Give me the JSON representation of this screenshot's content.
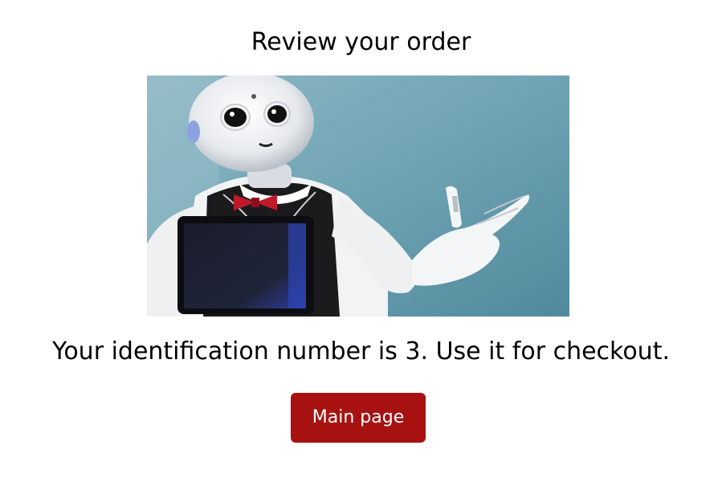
{
  "page": {
    "title": "Review your order",
    "message": "Your identification number is 3. Use it for checkout.",
    "main_page_button_label": "Main page"
  },
  "image": {
    "subject": "robot-photo"
  },
  "colors": {
    "button_background": "#a71211",
    "button_text": "#ffffff"
  }
}
